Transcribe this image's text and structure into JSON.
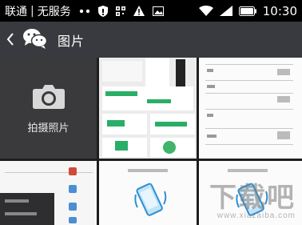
{
  "status_bar": {
    "carrier": "联通",
    "service": "无服务",
    "time": "10:30"
  },
  "title_bar": {
    "back_icon": "chevron-left-icon",
    "app_icon": "wechat-icon",
    "title": "图片"
  },
  "grid": {
    "camera": {
      "icon": "camera-icon",
      "label": "拍摄照片"
    },
    "thumbnail_count": 5
  },
  "watermark": {
    "text": "下载吧",
    "url": "www.xiazaiba.com"
  },
  "colors": {
    "title_bar": "#393a3f",
    "camera_tile": "#3a3a3d",
    "status_bar": "#000000"
  }
}
